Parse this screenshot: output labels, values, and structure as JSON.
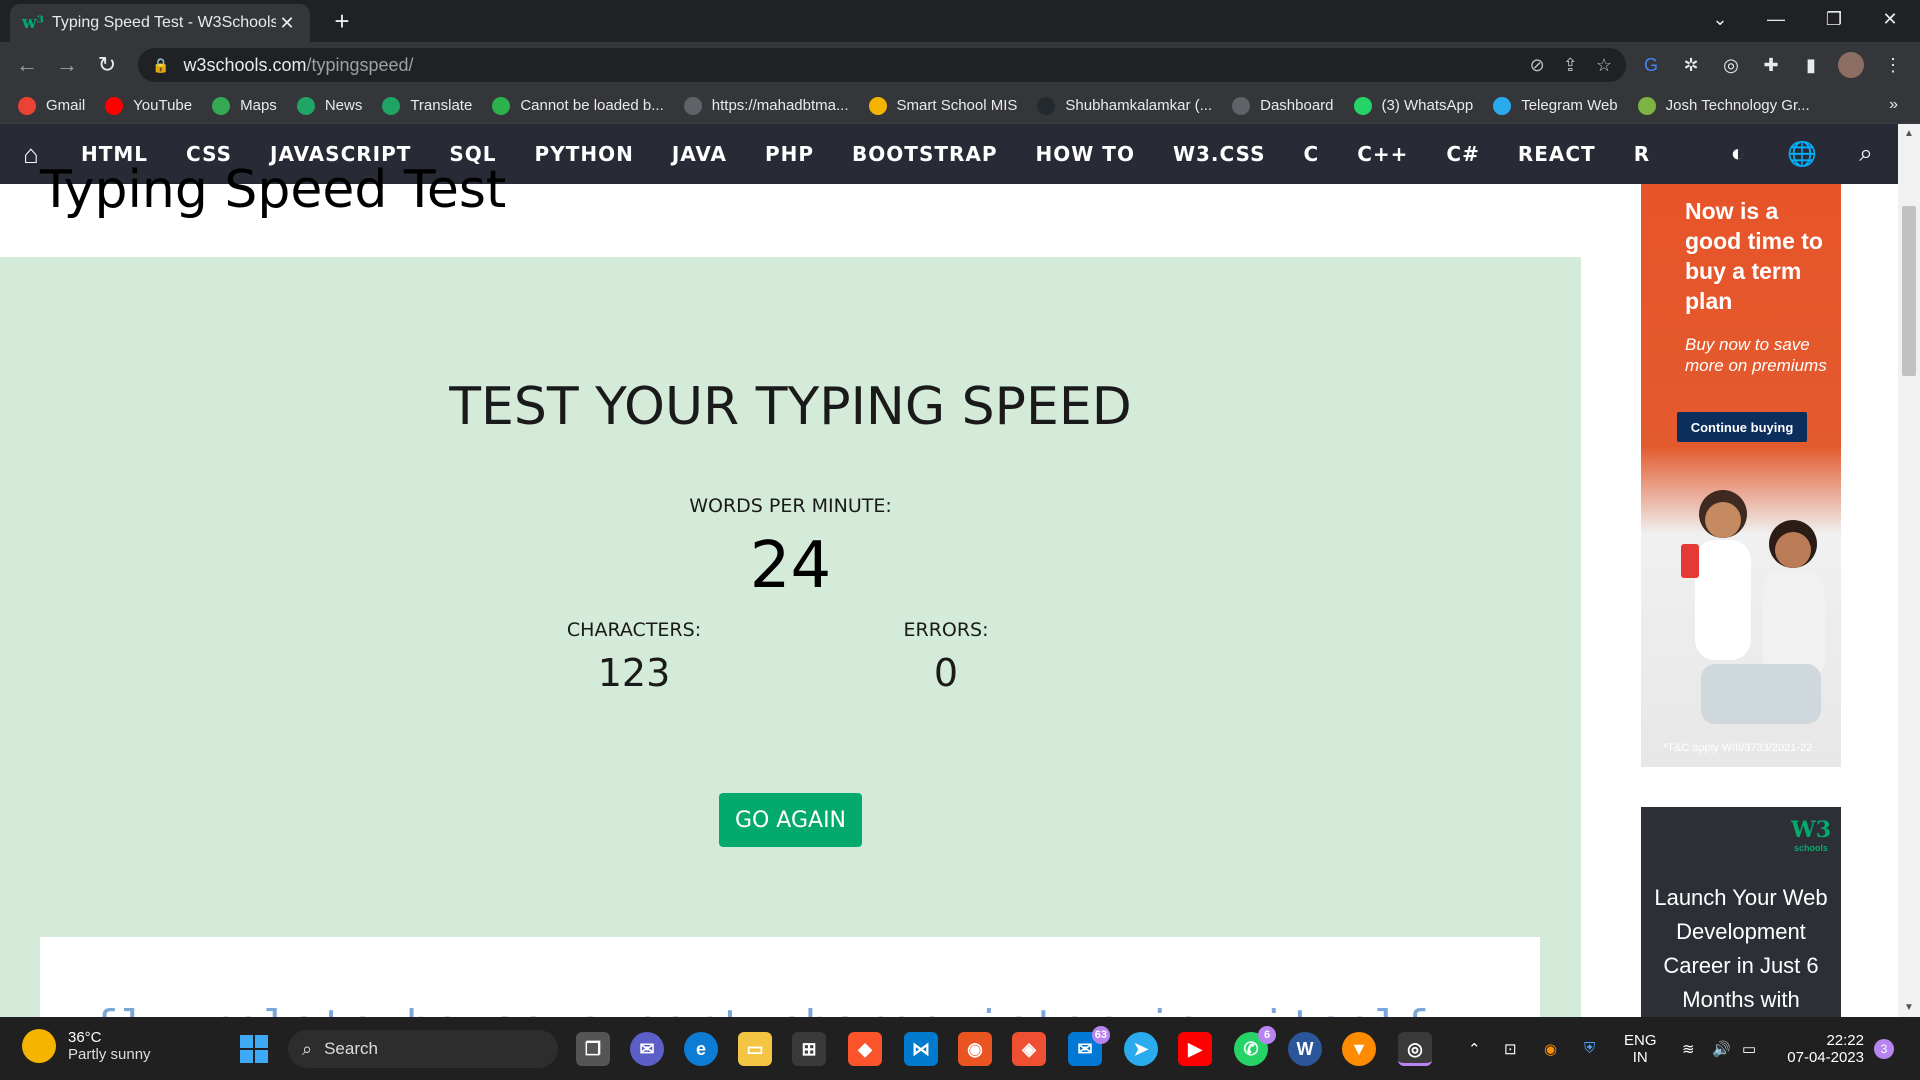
{
  "browser": {
    "tab_title": "Typing Speed Test - W3Schools",
    "tab_close": "✕",
    "new_tab": "+",
    "url_host": "w3schools.com",
    "url_path": "/typingspeed/",
    "window_controls": [
      "⌄",
      "—",
      "❐",
      "✕"
    ]
  },
  "bookmarks": [
    {
      "label": "Gmail",
      "icon": "gmail-icon",
      "color": "#ea4335"
    },
    {
      "label": "YouTube",
      "icon": "youtube-icon",
      "color": "#ff0000"
    },
    {
      "label": "Maps",
      "icon": "maps-icon",
      "color": "#34a853"
    },
    {
      "label": "News",
      "icon": "news-icon",
      "color": "#1fa463"
    },
    {
      "label": "Translate",
      "icon": "translate-icon",
      "color": "#1fa463"
    },
    {
      "label": "Cannot be loaded b...",
      "icon": "puzzle-icon",
      "color": "#2bb24c"
    },
    {
      "label": "https://mahadbtma...",
      "icon": "globe-icon",
      "color": "#5f6368"
    },
    {
      "label": "Smart School MIS",
      "icon": "smart-school-icon",
      "color": "#f4b400"
    },
    {
      "label": "Shubhamkalamkar (...",
      "icon": "github-icon",
      "color": "#24292e"
    },
    {
      "label": "Dashboard",
      "icon": "globe-icon",
      "color": "#5f6368"
    },
    {
      "label": "(3) WhatsApp",
      "icon": "whatsapp-icon",
      "color": "#25d366"
    },
    {
      "label": "Telegram Web",
      "icon": "telegram-icon",
      "color": "#2aabee"
    },
    {
      "label": "Josh Technology Gr...",
      "icon": "josh-icon",
      "color": "#7cb342"
    }
  ],
  "bookmarks_more": "»",
  "w3nav": {
    "items": [
      "HTML",
      "CSS",
      "JAVASCRIPT",
      "SQL",
      "PYTHON",
      "JAVA",
      "PHP",
      "BOOTSTRAP",
      "HOW TO",
      "W3.CSS",
      "C",
      "C++",
      "C#",
      "REACT",
      "R"
    ]
  },
  "page": {
    "title": "Typing Speed Test",
    "heading": "TEST YOUR TYPING SPEED",
    "wpm_label": "WORDS PER MINUTE:",
    "wpm_value": "24",
    "characters_label": "CHARACTERS:",
    "characters_value": "123",
    "errors_label": "ERRORS:",
    "errors_value": "0",
    "go_again": "GO AGAIN",
    "words_preview": "fly relate house expert charge interview itself"
  },
  "ads": {
    "ad1": {
      "headline": "Now is a good time to buy a term plan",
      "sub": "Buy now to save more on premiums",
      "cta": "Continue buying",
      "tnc": "*T&C apply W/II/3733/2021-22"
    },
    "ad2": {
      "logo": "W3",
      "logo_sub": "schools",
      "text": "Launch Your Web Development Career in Just 6 Months with"
    }
  },
  "taskbar": {
    "weather_temp": "36°C",
    "weather_desc": "Partly sunny",
    "search": "Search",
    "badges": {
      "mail": "63",
      "whatsapp": "6"
    },
    "lang1": "ENG",
    "lang2": "IN",
    "time": "22:22",
    "date": "07-04-2023",
    "notifications": "3"
  },
  "colors": {
    "accent": "#04aa6d",
    "nav_bg": "#282a35",
    "result_bg": "#d4ebd9"
  }
}
